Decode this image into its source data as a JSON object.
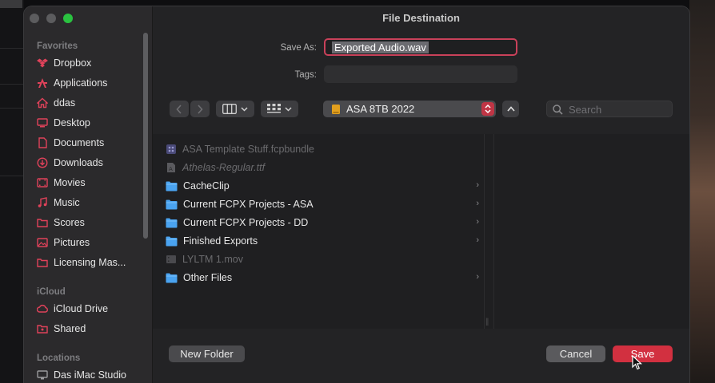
{
  "window": {
    "title": "File Destination"
  },
  "sidebar": {
    "favorites_header": "Favorites",
    "favorites": [
      {
        "label": "Dropbox",
        "icon": "dropbox-icon"
      },
      {
        "label": "Applications",
        "icon": "applications-icon"
      },
      {
        "label": "ddas",
        "icon": "home-icon"
      },
      {
        "label": "Desktop",
        "icon": "desktop-icon"
      },
      {
        "label": "Documents",
        "icon": "documents-icon"
      },
      {
        "label": "Downloads",
        "icon": "downloads-icon"
      },
      {
        "label": "Movies",
        "icon": "movies-icon"
      },
      {
        "label": "Music",
        "icon": "music-icon"
      },
      {
        "label": "Scores",
        "icon": "folder-icon"
      },
      {
        "label": "Pictures",
        "icon": "pictures-icon"
      },
      {
        "label": "Licensing Mas...",
        "icon": "folder-icon"
      }
    ],
    "icloud_header": "iCloud",
    "icloud": [
      {
        "label": "iCloud Drive",
        "icon": "cloud-icon"
      },
      {
        "label": "Shared",
        "icon": "shared-folder-icon"
      }
    ],
    "locations_header": "Locations",
    "locations": [
      {
        "label": "Das iMac Studio",
        "icon": "computer-icon"
      }
    ]
  },
  "form": {
    "save_as_label": "Save As:",
    "save_as_value": "Exported Audio.wav",
    "tags_label": "Tags:",
    "tags_value": ""
  },
  "toolbar": {
    "location": "ASA 8TB 2022",
    "search_placeholder": "Search"
  },
  "files": [
    {
      "name": "ASA Template Stuff.fcpbundle",
      "type": "bundle",
      "enabled": false,
      "folder": false
    },
    {
      "name": "Athelas-Regular.ttf",
      "type": "font",
      "enabled": false,
      "folder": false
    },
    {
      "name": "CacheClip",
      "type": "folder",
      "enabled": true,
      "folder": true
    },
    {
      "name": "Current FCPX Projects - ASA",
      "type": "folder",
      "enabled": true,
      "folder": true
    },
    {
      "name": "Current FCPX Projects - DD",
      "type": "folder",
      "enabled": true,
      "folder": true
    },
    {
      "name": "Finished Exports",
      "type": "folder",
      "enabled": true,
      "folder": true
    },
    {
      "name": "LYLTM 1.mov",
      "type": "movie",
      "enabled": false,
      "folder": false
    },
    {
      "name": "Other Files",
      "type": "folder",
      "enabled": true,
      "folder": true
    }
  ],
  "buttons": {
    "new_folder": "New Folder",
    "cancel": "Cancel",
    "save": "Save"
  },
  "colors": {
    "accent": "#d23040",
    "folder": "#4aa3f0",
    "window_bg": "#232325",
    "sidebar_icon": "#e0425a"
  }
}
